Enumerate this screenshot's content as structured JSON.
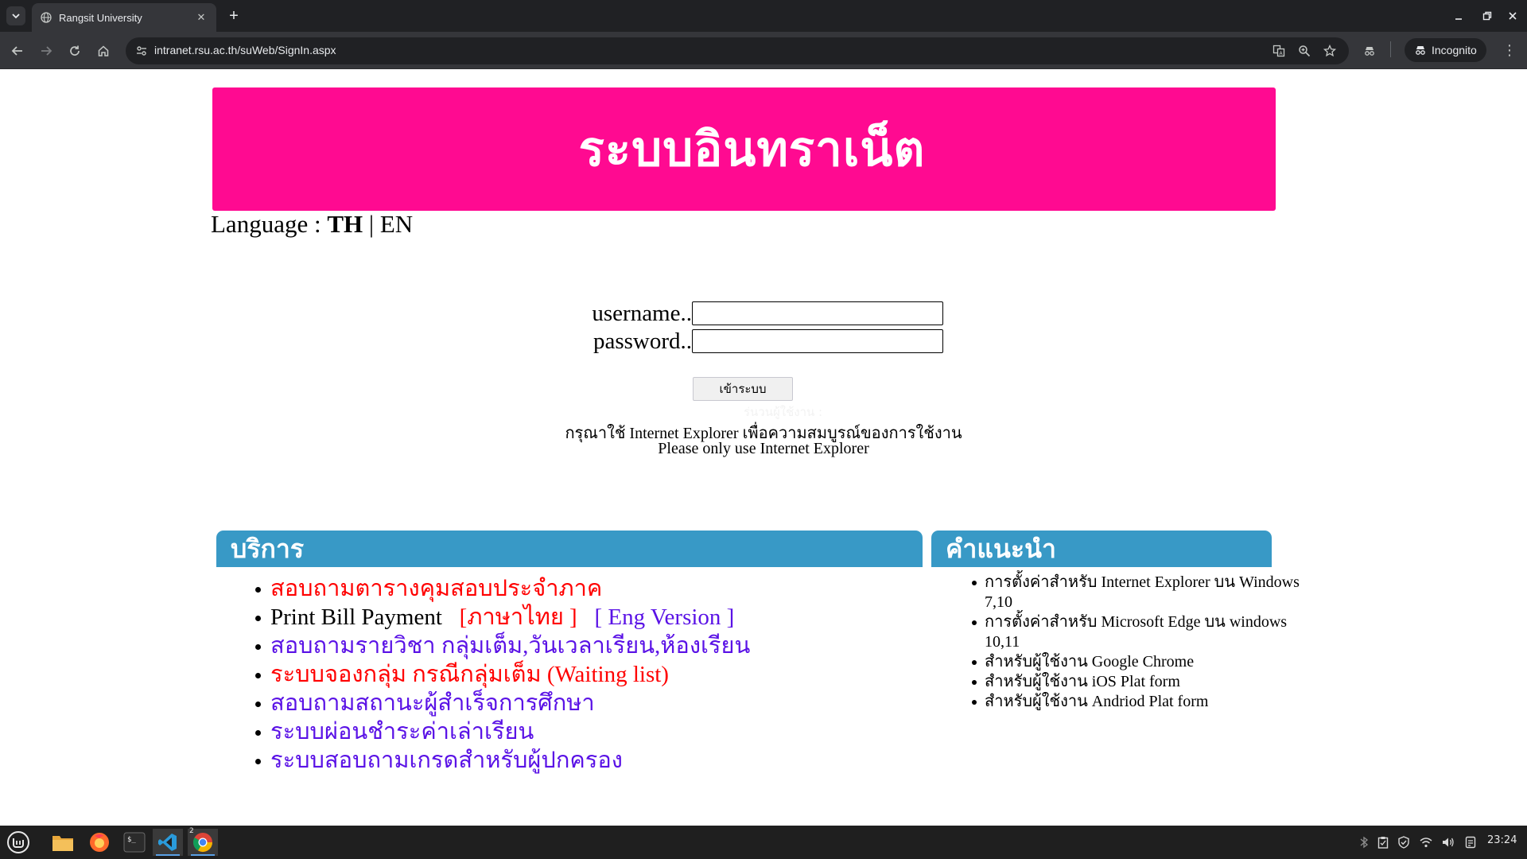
{
  "browser": {
    "tab_title": "Rangsit University",
    "url": "intranet.rsu.ac.th/suWeb/SignIn.aspx",
    "incognito_label": "Incognito"
  },
  "page": {
    "banner_title": "ระบบอินทราเน็ต",
    "language": {
      "prefix": "Language : ",
      "th": "TH",
      "separator": " | ",
      "en": "EN"
    },
    "login": {
      "username_label": "username..",
      "password_label": "password..",
      "username_value": "",
      "password_value": "",
      "submit_label": "เข้าระบบ",
      "ghost_text": "ร่นวนผู้ใช้งาน :",
      "note_th": "กรุณาใช้ Internet Explorer เพื่อความสมบูรณ์ของการใช้งาน",
      "note_en": "Please only use Internet Explorer"
    },
    "services": {
      "heading": "บริการ",
      "items": [
        {
          "label": "สอบถามตารางคุมสอบประจำภาค"
        },
        {
          "label": "Print Bill Payment",
          "link_th": "[ภาษาไทย ]",
          "link_en": "[ Eng Version ]"
        },
        {
          "label": "สอบถามรายวิชา กลุ่มเต็ม,วันเวลาเรียน,ห้องเรียน"
        },
        {
          "label": "ระบบจองกลุ่ม กรณีกลุ่มเต็ม (Waiting list)"
        },
        {
          "label": "สอบถามสถานะผู้สำเร็จการศึกษา"
        },
        {
          "label": "ระบบผ่อนชำระค่าเล่าเรียน"
        },
        {
          "label": "ระบบสอบถามเกรดสำหรับผู้ปกครอง"
        }
      ]
    },
    "tips": {
      "heading": "คำแนะนำ",
      "items": [
        "การตั้งค่าสำหรับ Internet Explorer บน Windows 7,10",
        "การตั้งค่าสำหรับ Microsoft Edge บน windows 10,11",
        "สำหรับผู้ใช้งาน Google Chrome",
        "สำหรับผู้ใช้งาน iOS Plat form",
        "สำหรับผู้ใช้งาน Andriod Plat form"
      ]
    }
  },
  "colors": {
    "banner": "#ff0a91",
    "panel_head": "#3899c6",
    "link_red": "#ff0000",
    "link_purple": "#5a12e6"
  },
  "taskbar": {
    "apps": [
      "linux-mint-menu-icon",
      "files-icon",
      "firefox-icon",
      "terminal-icon",
      "vscode-icon",
      "chrome-icon"
    ],
    "chrome_badge": "2",
    "clock": "23:24"
  }
}
